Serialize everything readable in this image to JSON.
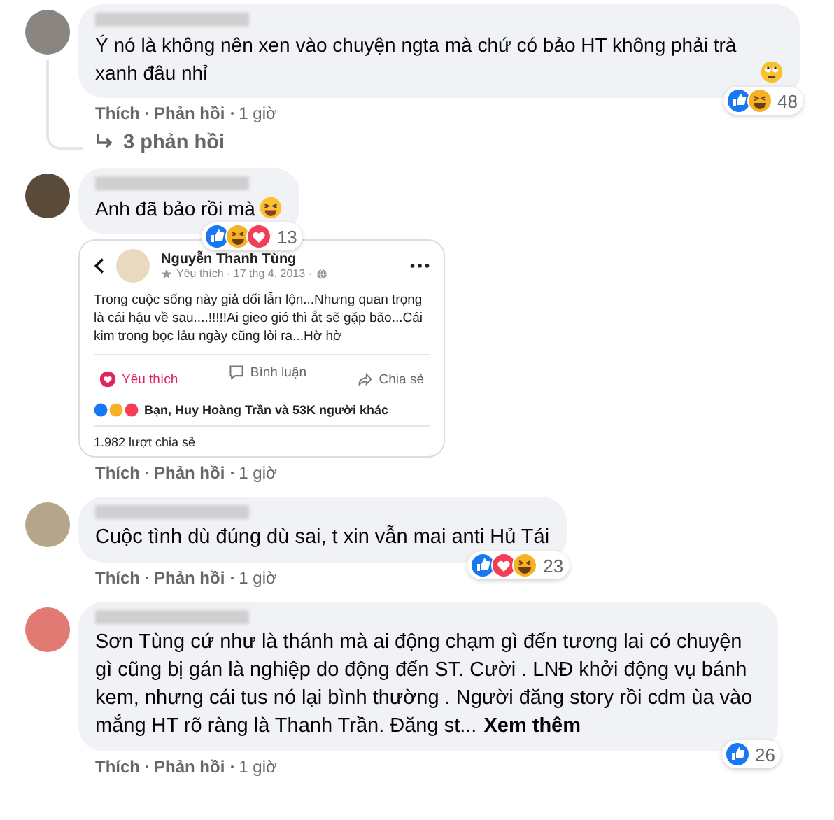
{
  "comments": [
    {
      "text": "Ý nó là không nên xen vào chuyện ngta mà chứ có bảo HT không phải trà xanh đâu nhỉ",
      "emoji": {
        "kind": "eyeroll"
      },
      "reactions": [
        {
          "kind": "like"
        },
        {
          "kind": "haha"
        }
      ],
      "reaction_count": "48",
      "actions": [
        "Thích",
        "Phản hồi"
      ],
      "time": "1 giờ",
      "replies": "3 phản hồi"
    },
    {
      "text": "Anh đã bảo rồi mà",
      "emoji": {
        "kind": "laugh"
      },
      "attachment": {
        "author": "Nguyễn Thanh Tùng",
        "meta": "Yêu thích · 17 thg 4, 2013 ·",
        "text": "Trong cuộc sống này giả dối lẫn lộn...Nhưng quan trọng là cái hậu về sau....!!!!!Ai gieo gió thì ắt sẽ gặp bão...Cái kim trong bọc lâu ngày cũng lòi ra...Hờ hờ",
        "actions": [
          {
            "kind": "love",
            "label": "Yêu thích"
          },
          {
            "kind": "comment",
            "label": "Bình luận"
          },
          {
            "kind": "share",
            "label": "Chia sẻ"
          }
        ],
        "summary_reactions": [
          {
            "kind": "like"
          },
          {
            "kind": "haha"
          },
          {
            "kind": "love"
          }
        ],
        "summary": "Bạn, Huy Hoàng Trần và 53K người khác",
        "shares": "1.982 lượt chia sẻ"
      },
      "reactions": [
        {
          "kind": "like"
        },
        {
          "kind": "haha"
        },
        {
          "kind": "love"
        }
      ],
      "reaction_count": "13",
      "actions": [
        "Thích",
        "Phản hồi"
      ],
      "time": "1 giờ"
    },
    {
      "text": "Cuộc tình dù đúng dù sai, t xin vẫn mai anti Hủ Tái",
      "reactions": [
        {
          "kind": "like"
        },
        {
          "kind": "love"
        },
        {
          "kind": "haha"
        }
      ],
      "reaction_count": "23",
      "actions": [
        "Thích",
        "Phản hồi"
      ],
      "time": "1 giờ"
    },
    {
      "text": "Sơn Tùng cứ như là thánh mà ai động chạm gì đến tương lai có chuyện gì cũng bị gán là nghiệp do động đến ST. Cười . LNĐ khởi động vụ bánh kem, nhưng cái tus nó lại bình thường . Người đăng story rồi cdm ùa vào mắng HT rõ ràng là Thanh Trần. Đăng st...",
      "see_more": "Xem thêm",
      "reactions": [
        {
          "kind": "like"
        }
      ],
      "reaction_count": "26",
      "actions": [
        "Thích",
        "Phản hồi"
      ],
      "time": "1 giờ"
    }
  ]
}
